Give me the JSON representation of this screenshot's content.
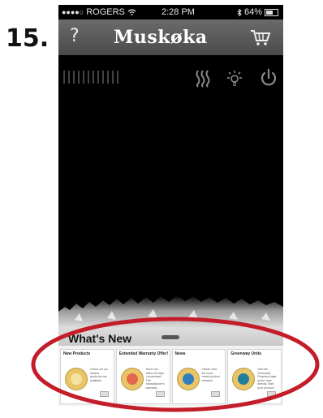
{
  "step_label": "15.",
  "status_bar": {
    "carrier": "ROGERS",
    "signal_dots": "●●●●○",
    "time": "2:28 PM",
    "battery_text": "64%",
    "battery_level": 0.64
  },
  "nav": {
    "help_label": "?",
    "brand": "Muskøka"
  },
  "controls": [
    "heat-icon",
    "light-icon",
    "power-icon"
  ],
  "whats_new": {
    "title": "What's New",
    "cards": [
      {
        "title": "New Products",
        "badge_text": "NEW PRODUCTS",
        "text": "Check out our newest products now available.",
        "badge_color": "#f0e4a0"
      },
      {
        "title": "Extended Warranty Offer!",
        "text": "Send one within 30 days of purchase! The manufacturer's warranty...",
        "badge_color": "#e5664d"
      },
      {
        "title": "News",
        "text": "Please view the most recent product releases.",
        "badge_color": "#2f7fbf"
      },
      {
        "title": "Greenway Units",
        "text": "Visit the Greenway Fireplace page at the store directly. Start your product!",
        "badge_color": "#1f7f9a"
      }
    ]
  },
  "colors": {
    "nav_top": "#6b6b6b",
    "nav_bottom": "#4a4a4a",
    "annotation_ring": "#c41d2a",
    "control_icon": "#8a8a8a"
  }
}
